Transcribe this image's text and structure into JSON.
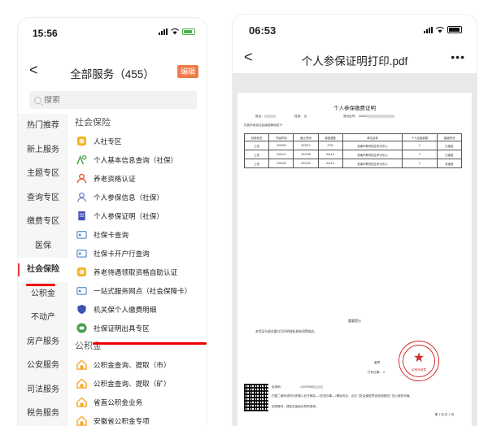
{
  "left_phone": {
    "status_time": "15:56",
    "nav": {
      "back_glyph": "<",
      "title": "全部服务（455）",
      "edit_label": "编辑"
    },
    "search": {
      "placeholder": "搜索"
    },
    "sidebar": [
      {
        "label": "热门推荐"
      },
      {
        "label": "新上服务"
      },
      {
        "label": "主题专区"
      },
      {
        "label": "查询专区"
      },
      {
        "label": "缴费专区"
      },
      {
        "label": "医保"
      },
      {
        "label": "社会保险",
        "active": true
      },
      {
        "label": "公积金"
      },
      {
        "label": "不动产"
      },
      {
        "label": "房产服务"
      },
      {
        "label": "公安服务"
      },
      {
        "label": "司法服务"
      },
      {
        "label": "税务服务"
      }
    ],
    "section_social": "社会保险",
    "social_services": [
      {
        "label": "人社专区",
        "icon": "id-badge-icon",
        "color": "#f5b323"
      },
      {
        "label": "个人基本信息查询（社保）",
        "icon": "person-location-icon",
        "color": "#43a047"
      },
      {
        "label": "养老资格认证",
        "icon": "person-icon",
        "color": "#e65a3a"
      },
      {
        "label": "个人参保信息（社保）",
        "icon": "person-outline-icon",
        "color": "#5c6bc0"
      },
      {
        "label": "个人参保证明（社保）",
        "icon": "document-icon",
        "color": "#3f51b5"
      },
      {
        "label": "社保卡查询",
        "icon": "card-icon",
        "color": "#5c8fd6"
      },
      {
        "label": "社保卡开户行查询",
        "icon": "card-icon",
        "color": "#5c8fd6"
      },
      {
        "label": "养老待遇领取资格自助认证",
        "icon": "id-badge-icon",
        "color": "#f5b323"
      },
      {
        "label": "一站式服务网点（社会保障卡）",
        "icon": "card-icon",
        "color": "#5c8fd6"
      },
      {
        "label": "机关保个人缴费明细",
        "icon": "shield-icon",
        "color": "#3f51b5"
      },
      {
        "label": "社保证明出具专区",
        "icon": "print-icon",
        "color": "#43a047"
      }
    ],
    "section_fund": "公积金",
    "fund_services": [
      {
        "label": "公积金查询、提取（市）",
        "icon": "house-icon",
        "color": "#f5a623"
      },
      {
        "label": "公积金查询、提取（矿）",
        "icon": "house-icon",
        "color": "#f5a623"
      },
      {
        "label": "省直公积金业务",
        "icon": "house-icon",
        "color": "#f5a623"
      },
      {
        "label": "安徽省公积金专项",
        "icon": "house-icon",
        "color": "#f5a623"
      }
    ]
  },
  "right_phone": {
    "status_time": "06:53",
    "nav": {
      "back_glyph": "<",
      "title": "个人参保证明打印.pdf",
      "more_glyph": "•••"
    },
    "doc": {
      "title": "个人参保缴费证明",
      "name_label": "姓名：",
      "gender_label": "性别：",
      "gender_value": "女",
      "id_label": "身份证号：",
      "id_value": "34042",
      "info_line": "在我市参加社会保险情况如下：",
      "table_headers": [
        "险种状态",
        "开始时间",
        "截止时间",
        "缴费基数",
        "单位名称",
        "个人应缴费额",
        "缴费情况"
      ],
      "table_rows": [
        [
          "工伤",
          "202009",
          "202012",
          "4792",
          "淮南市教育招生考试中心",
          "0",
          "已缴费"
        ],
        [
          "工伤",
          "202101",
          "202108",
          "5114.5",
          "淮南市教育招生考试中心",
          "0",
          "已缴费"
        ],
        [
          "工伤",
          "202109",
          "202109",
          "5114.5",
          "淮南市教育招生考试中心",
          "0",
          "未缴费"
        ]
      ],
      "notice_title": "重要提示",
      "notice_text": "本凭证与经办窗口打印的材料具有同等效应。",
      "seal_label": "盖章",
      "print_date_label": "打印日期：",
      "print_date_value": "2",
      "stamp_text": "证明专用章",
      "verify_code_label": "检真码：",
      "verify_code_value": "CZXP39A",
      "verify_line1": "扫描二维码或访问安徽人社厅网站—>在线办事—>便民热点，点击【社会保险凭证检验服务】进入服务页面。",
      "verify_line2": "如有疑问，请至社保经办机构咨询。",
      "page_number": "第 1 页 共 1 页"
    }
  }
}
